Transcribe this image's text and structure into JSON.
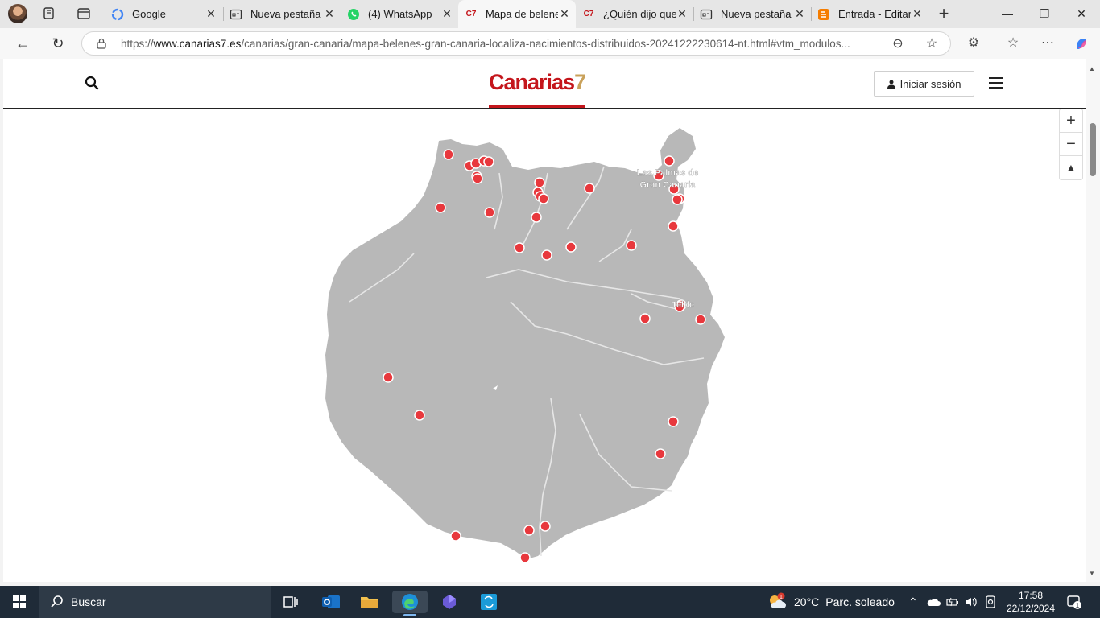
{
  "browser": {
    "tabs": [
      {
        "title": "Google",
        "favicon": "google-icon",
        "active": false
      },
      {
        "title": "Nueva pestaña",
        "favicon": "newtab-icon",
        "active": false
      },
      {
        "title": "(4) WhatsApp",
        "favicon": "whatsapp-icon",
        "active": false
      },
      {
        "title": "Mapa de belenes",
        "favicon": "c7-icon",
        "active": true
      },
      {
        "title": "¿Quién dijo que",
        "favicon": "c7-icon",
        "active": false
      },
      {
        "title": "Nueva pestaña",
        "favicon": "newtab-icon",
        "active": false
      },
      {
        "title": "Entrada - Editar",
        "favicon": "blogger-icon",
        "active": false
      }
    ],
    "favicon_c7_label": "C7",
    "url_prefix": "https://",
    "url_domain": "www.canarias7.es",
    "url_path": "/canarias/gran-canaria/mapa-belenes-gran-canaria-localiza-nacimientos-distribuidos-20241222230614-nt.html#vtm_modulos..."
  },
  "site": {
    "logo_main": "Canarias",
    "logo_number": "7",
    "login_label": "Iniciar sesión"
  },
  "map": {
    "labels": {
      "las_palmas_line1": "Las Palmas de",
      "las_palmas_line2": "Gran Canaria",
      "telde": "Telde"
    },
    "zoom_in": "+",
    "zoom_out": "−",
    "reset": "▲",
    "marker_color": "#e8383d",
    "island_color": "#b8b8b8",
    "marker_count": 41
  },
  "taskbar": {
    "search_placeholder": "Buscar",
    "weather_temp": "20°C",
    "weather_desc": "Parc. soleado",
    "weather_badge": "1",
    "time": "17:58",
    "date": "22/12/2024",
    "notif_count": "1"
  }
}
